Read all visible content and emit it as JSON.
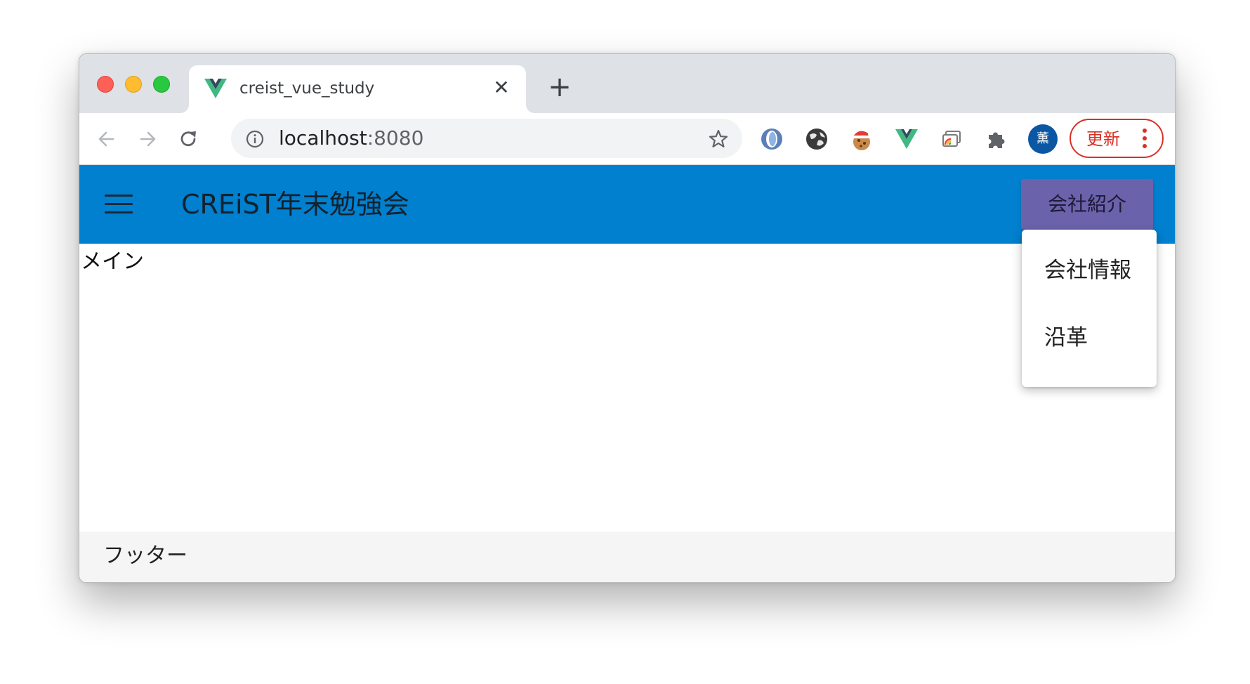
{
  "browser": {
    "tab": {
      "title": "creist_vue_study",
      "close_glyph": "✕",
      "favicon": "vue-logo-icon"
    },
    "new_tab_glyph": "+",
    "address": {
      "host": "localhost",
      "port": ":8080"
    },
    "profile_initial": "薫",
    "update_label": "更新",
    "extensions": [
      "blue-ring-extension-icon",
      "globe-extension-icon",
      "santa-cookie-extension-icon",
      "vue-devtools-icon",
      "cast-extension-icon",
      "puzzle-extensions-icon"
    ]
  },
  "app": {
    "title": "CREiST年末勉強会",
    "menu_button_label": "会社紹介",
    "menu_items": [
      "会社情報",
      "沿革"
    ],
    "main_text": "メイン",
    "footer_text": "フッター",
    "colors": {
      "appbar": "#0080cf",
      "menu_button": "#6b62ac",
      "footer": "#f5f5f5",
      "update_accent": "#d93025"
    }
  }
}
